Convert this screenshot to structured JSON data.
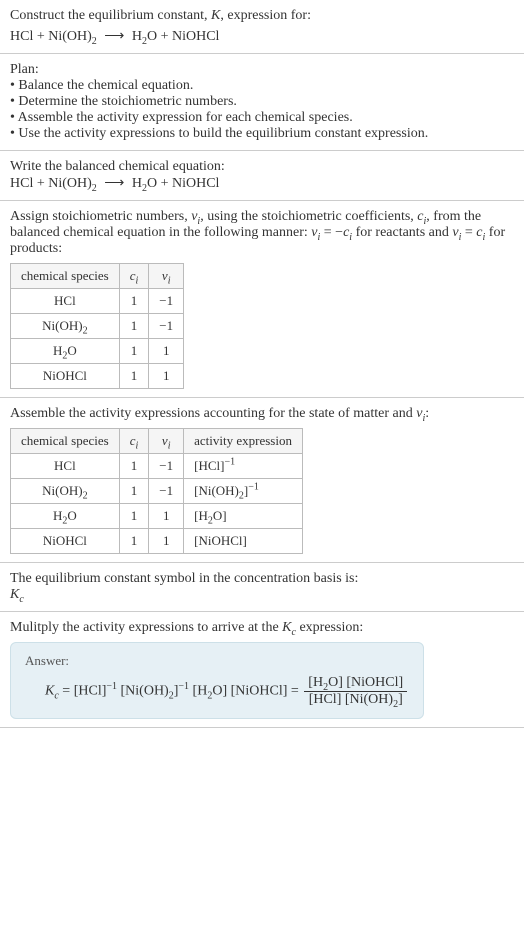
{
  "header": {
    "line1_a": "Construct the equilibrium constant, ",
    "line1_k": "K",
    "line1_b": ", expression for:",
    "eq_lhs": "HCl + Ni(OH)",
    "eq_lhs_sub": "2",
    "eq_rhs_a": "H",
    "eq_rhs_a_sub": "2",
    "eq_rhs_b": "O + NiOHCl"
  },
  "plan": {
    "title": "Plan:",
    "b1": "• Balance the chemical equation.",
    "b2": "• Determine the stoichiometric numbers.",
    "b3": "• Assemble the activity expression for each chemical species.",
    "b4": "• Use the activity expressions to build the equilibrium constant expression."
  },
  "balanced": {
    "title": "Write the balanced chemical equation:",
    "eq_lhs": "HCl + Ni(OH)",
    "eq_lhs_sub": "2",
    "eq_rhs_a": "H",
    "eq_rhs_a_sub": "2",
    "eq_rhs_b": "O + NiOHCl"
  },
  "stoich": {
    "intro_a": "Assign stoichiometric numbers, ",
    "intro_nu": "ν",
    "intro_i": "i",
    "intro_b": ", using the stoichiometric coefficients, ",
    "intro_c": "c",
    "intro_c_i": "i",
    "intro_d": ", from the balanced chemical equation in the following manner: ",
    "rel1_a": "ν",
    "rel1_i": "i",
    "rel1_eq": " = −",
    "rel1_c": "c",
    "rel1_ci": "i",
    "intro_e": " for reactants and ",
    "rel2_a": "ν",
    "rel2_i": "i",
    "rel2_eq": " = ",
    "rel2_c": "c",
    "rel2_ci": "i",
    "intro_f": " for products:",
    "h1": "chemical species",
    "h2_c": "c",
    "h2_i": "i",
    "h3_nu": "ν",
    "h3_i": "i",
    "rows": [
      {
        "sp": "HCl",
        "c": "1",
        "nu": "−1"
      },
      {
        "sp_a": "Ni(OH)",
        "sp_sub": "2",
        "c": "1",
        "nu": "−1"
      },
      {
        "sp_a": "H",
        "sp_sub": "2",
        "sp_b": "O",
        "c": "1",
        "nu": "1"
      },
      {
        "sp": "NiOHCl",
        "c": "1",
        "nu": "1"
      }
    ]
  },
  "activity": {
    "title_a": "Assemble the activity expressions accounting for the state of matter and ",
    "title_nu": "ν",
    "title_i": "i",
    "title_b": ":",
    "h1": "chemical species",
    "h2_c": "c",
    "h2_i": "i",
    "h3_nu": "ν",
    "h3_i": "i",
    "h4": "activity expression",
    "rows": [
      {
        "sp": "HCl",
        "c": "1",
        "nu": "−1",
        "act": "[HCl]",
        "act_sup": "−1"
      },
      {
        "sp_a": "Ni(OH)",
        "sp_sub": "2",
        "c": "1",
        "nu": "−1",
        "act_a": "[Ni(OH)",
        "act_sub": "2",
        "act_b": "]",
        "act_sup": "−1"
      },
      {
        "sp_a": "H",
        "sp_sub": "2",
        "sp_b": "O",
        "c": "1",
        "nu": "1",
        "act_a": "[H",
        "act_sub": "2",
        "act_b": "O]"
      },
      {
        "sp": "NiOHCl",
        "c": "1",
        "nu": "1",
        "act": "[NiOHCl]"
      }
    ]
  },
  "symbol": {
    "line": "The equilibrium constant symbol in the concentration basis is:",
    "k": "K",
    "c": "c"
  },
  "multiply": {
    "line_a": "Mulitply the activity expressions to arrive at the ",
    "k": "K",
    "c": "c",
    "line_b": " expression:"
  },
  "answer": {
    "label": "Answer:",
    "k": "K",
    "c": "c",
    "eq": " = ",
    "t1": "[HCl]",
    "t1_sup": "−1",
    "sp": " ",
    "t2a": "[Ni(OH)",
    "t2sub": "2",
    "t2b": "]",
    "t2_sup": "−1",
    "t3a": "[H",
    "t3sub": "2",
    "t3b": "O]",
    "t4": "[NiOHCl]",
    "eq2": " = ",
    "num_a": "[H",
    "num_sub": "2",
    "num_b": "O] [NiOHCl]",
    "den_a": "[HCl] [Ni(OH)",
    "den_sub": "2",
    "den_b": "]"
  }
}
